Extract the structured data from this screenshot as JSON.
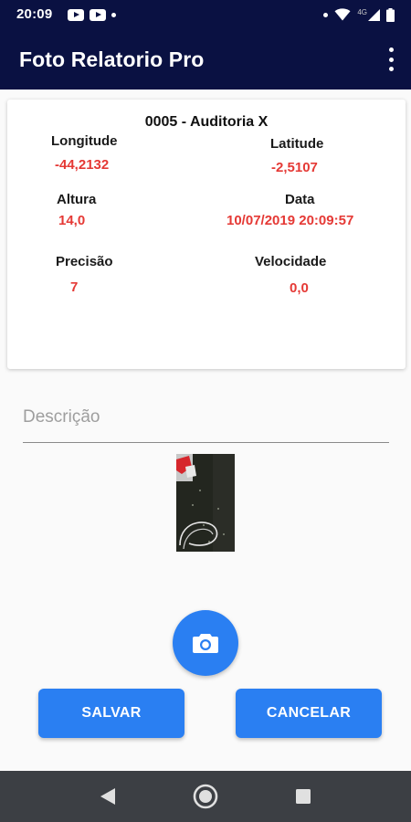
{
  "status_bar": {
    "time": "20:09",
    "network": "4G"
  },
  "app_bar": {
    "title": "Foto Relatorio Pro"
  },
  "card": {
    "title": "0005 - Auditoria X",
    "fields": [
      {
        "label": "Longitude",
        "value": "-44,2132"
      },
      {
        "label": "Latitude",
        "value": "-2,5107"
      },
      {
        "label": "Altura",
        "value": "14,0"
      },
      {
        "label": "Data",
        "value": "10/07/2019 20:09:57"
      },
      {
        "label": "Precisão",
        "value": "7"
      },
      {
        "label": "Velocidade",
        "value": "0,0"
      }
    ]
  },
  "description": {
    "placeholder": "Descrição",
    "value": ""
  },
  "buttons": {
    "save": "SALVAR",
    "cancel": "CANCELAR"
  },
  "icons": {
    "camera": "camera-icon",
    "more": "more-vert-icon",
    "back": "nav-back-icon",
    "home": "nav-home-icon",
    "recents": "nav-recents-icon"
  },
  "colors": {
    "app_bar": "#0a1142",
    "accent": "#2a7ff2",
    "value_red": "#e53935",
    "nav_bar": "#3c3f44"
  }
}
